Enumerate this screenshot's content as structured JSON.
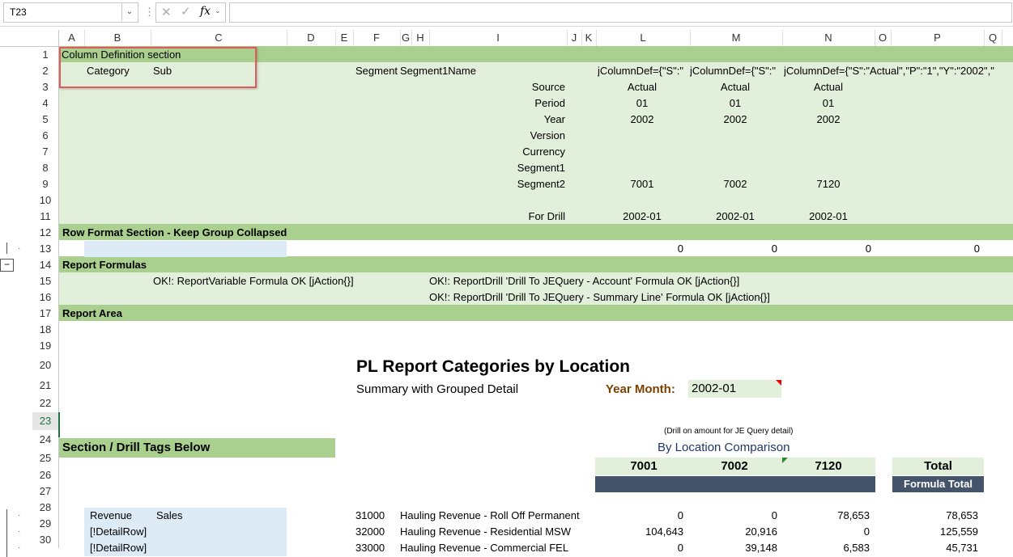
{
  "formula_bar": {
    "name_box": "T23",
    "fx": "fx",
    "formula": ""
  },
  "columns": [
    "A",
    "B",
    "C",
    "D",
    "E",
    "F",
    "G",
    "H",
    "I",
    "J",
    "K",
    "L",
    "M",
    "N",
    "O",
    "P",
    "Q"
  ],
  "outline_levels": [
    "1",
    "2"
  ],
  "rows": [
    "1",
    "2",
    "3",
    "4",
    "5",
    "6",
    "7",
    "8",
    "9",
    "10",
    "11",
    "12",
    "13",
    "14",
    "15",
    "16",
    "17",
    "18",
    "19",
    "20",
    "21",
    "22",
    "23",
    "24",
    "25",
    "26",
    "27",
    "28",
    "29",
    "30"
  ],
  "selected_row": "23",
  "r1": {
    "a": "Column Definition section"
  },
  "r2": {
    "b": "Category",
    "c": "Sub",
    "f": "Segment",
    "g": "Segment1Name",
    "l": "jColumnDef={\"S\":\"",
    "m": "jColumnDef={\"S\":\"",
    "n": "jColumnDef={\"S\":\"Actual\",\"P\":\"1\",\"Y\":\"2002\",\""
  },
  "coldef_labels": [
    "Source",
    "Period",
    "Year",
    "Version",
    "Currency",
    "Segment1",
    "Segment2",
    "",
    "For Drill"
  ],
  "coldef_L": [
    "Actual",
    "01",
    "2002",
    "",
    "",
    "",
    "7001",
    "",
    "2002-01"
  ],
  "coldef_M": [
    "Actual",
    "01",
    "2002",
    "",
    "",
    "",
    "7002",
    "",
    "2002-01"
  ],
  "coldef_N": [
    "Actual",
    "01",
    "2002",
    "",
    "",
    "",
    "7120",
    "",
    "2002-01"
  ],
  "r12": "Row Format Section - Keep Group Collapsed",
  "r13": {
    "l": "0",
    "m": "0",
    "n": "0",
    "p": "0"
  },
  "r14": "Report Formulas",
  "r15": {
    "c": "OK!: ReportVariable Formula OK [jAction{}]",
    "i": "OK!: ReportDrill 'Drill To JEQuery - Account' Formula OK [jAction{}]"
  },
  "r16": {
    "i": "OK!: ReportDrill 'Drill To JEQuery - Summary Line' Formula OK [jAction{}]"
  },
  "r17": "Report Area",
  "report": {
    "title": "PL Report Categories by Location",
    "subtitle": "Summary with Grouped Detail",
    "ym_label": "Year Month:",
    "ym_value": "2002-01",
    "drill_note": "(Drill on amount for JE Query detail)",
    "comparison": "By Location Comparison",
    "loc1": "7001",
    "loc2": "7002",
    "loc3": "7120",
    "total": "Total",
    "formula_total": "Formula Total"
  },
  "r24": "Section / Drill Tags Below",
  "detail": [
    {
      "b": "Revenue",
      "c": "Sales",
      "f": "31000",
      "g": "Hauling Revenue - Roll Off Permanent",
      "l": "0",
      "m": "0",
      "n": "78,653",
      "p": "78,653"
    },
    {
      "b": "[!DetailRow]",
      "c": "",
      "f": "32000",
      "g": "Hauling Revenue - Residential MSW",
      "l": "104,643",
      "m": "20,916",
      "n": "0",
      "p": "125,559"
    },
    {
      "b": "[!DetailRow]",
      "c": "",
      "f": "33000",
      "g": "Hauling Revenue - Commercial FEL",
      "l": "0",
      "m": "39,148",
      "n": "6,583",
      "p": "45,731"
    }
  ],
  "colors": {
    "light_green": "#e2efda",
    "mid_green": "#a9d08e",
    "dark_band": "#44546a",
    "light_blue": "#ddebf7",
    "highlight": "#e05a5a"
  }
}
